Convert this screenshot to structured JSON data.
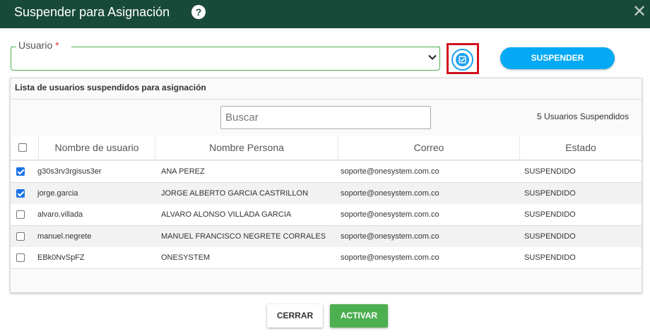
{
  "dialog": {
    "title": "Suspender para Asignación",
    "help_glyph": "?",
    "close_glyph": "✕"
  },
  "form": {
    "user_label": "Usuario",
    "required_mark": "*",
    "user_value": "",
    "suspend_button": "SUSPENDER"
  },
  "list": {
    "title": "Lista de usuarios suspendidos para asignación",
    "search_placeholder": "Buscar",
    "count_text": "5 Usuarios Suspendidos",
    "columns": [
      "Nombre de usuario",
      "Nombre Persona",
      "Correo",
      "Estado"
    ],
    "rows": [
      {
        "checked": true,
        "username": "g30s3rv3rgisus3er",
        "person": "ANA PEREZ",
        "email": "soporte@onesystem.com.co",
        "status": "SUSPENDIDO"
      },
      {
        "checked": true,
        "username": "jorge.garcia",
        "person": "JORGE ALBERTO GARCIA CASTRILLON",
        "email": "soporte@onesystem.com.co",
        "status": "SUSPENDIDO"
      },
      {
        "checked": false,
        "username": "alvaro.villada",
        "person": "ALVARO ALONSO VILLADA GARCIA",
        "email": "soporte@onesystem.com.co",
        "status": "SUSPENDIDO"
      },
      {
        "checked": false,
        "username": "manuel.negrete",
        "person": "MANUEL FRANCISCO NEGRETE CORRALES",
        "email": "soporte@onesystem.com.co",
        "status": "SUSPENDIDO"
      },
      {
        "checked": false,
        "username": "EBk0NvSpFZ",
        "person": "ONESYSTEM",
        "email": "soporte@onesystem.com.co",
        "status": "SUSPENDIDO"
      }
    ]
  },
  "footer": {
    "close_button": "CERRAR",
    "activate_button": "ACTIVAR"
  },
  "colors": {
    "header_bg": "#184a39",
    "accent_blue": "#03a9f4",
    "highlight_red": "#d0121e",
    "activate_green": "#4caf50"
  }
}
